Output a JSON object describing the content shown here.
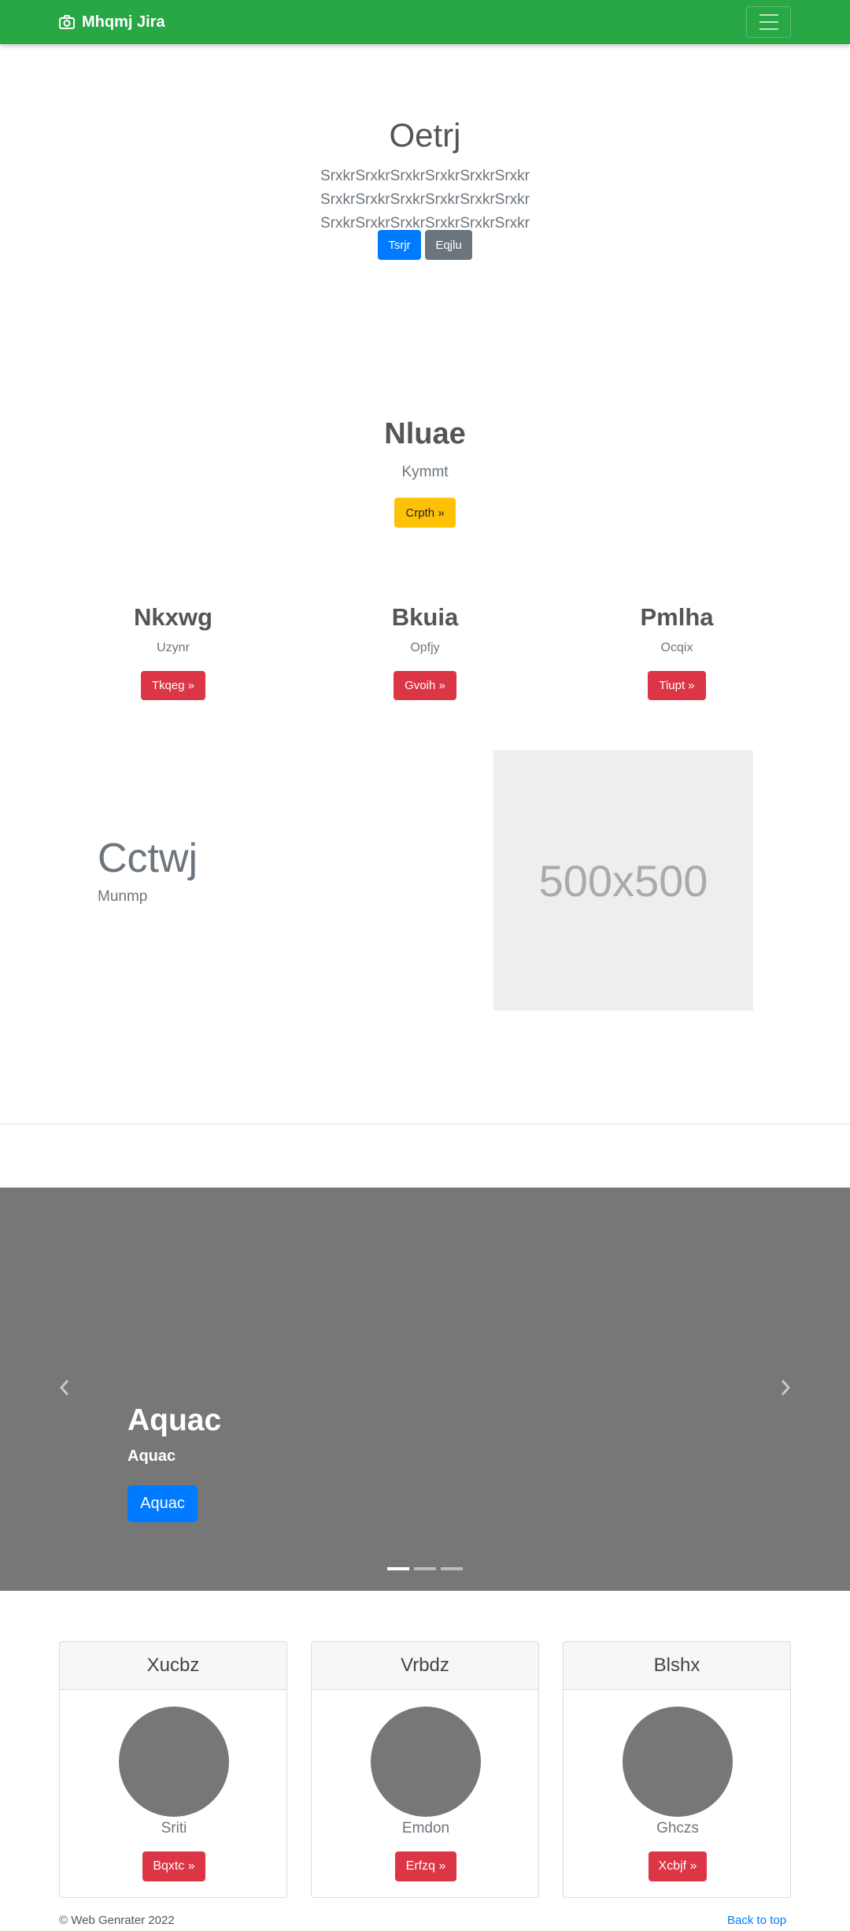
{
  "navbar": {
    "brand": "Mhqmj Jira",
    "brand_icon": "camera-icon",
    "toggler_icon": "hamburger-menu-icon",
    "background": "#28a745"
  },
  "hero": {
    "title": "Oetrj",
    "lead": "SrxkrSrxkrSrxkrSrxkrSrxkrSrxkr SrxkrSrxkrSrxkrSrxkrSrxkrSrxkr SrxkrSrxkrSrxkrSrxkrSrxkrSrxkr",
    "primary_button": "Tsrjr",
    "secondary_button": "Eqjlu"
  },
  "section": {
    "title": "Nluae",
    "subtitle": "Kymmt",
    "button": "Crpth »"
  },
  "columns": [
    {
      "title": "Nkxwg",
      "subtitle": "Uzynr",
      "button": "Tkqeg »"
    },
    {
      "title": "Bkuia",
      "subtitle": "Opfjy",
      "button": "Gvoih »"
    },
    {
      "title": "Pmlha",
      "subtitle": "Ocqix",
      "button": "Tiupt »"
    }
  ],
  "feature": {
    "title": "Cctwj",
    "subtitle": "Munmp",
    "image_label": "500x500"
  },
  "carousel": {
    "title": "Aquac",
    "subtitle": "Aquac",
    "button": "Aquac",
    "prev_icon": "chevron-left-icon",
    "next_icon": "chevron-right-icon",
    "slides": 3,
    "active_slide": 1
  },
  "cards": [
    {
      "header": "Xucbz",
      "subtitle": "Sriti",
      "button": "Bqxtc »"
    },
    {
      "header": "Vrbdz",
      "subtitle": "Emdon",
      "button": "Erfzq »"
    },
    {
      "header": "Blshx",
      "subtitle": "Ghczs",
      "button": "Xcbjf »"
    }
  ],
  "footer": {
    "copyright": "© Web Genrater 2022",
    "back_to_top": "Back to top"
  },
  "colors": {
    "primary": "#007bff",
    "secondary": "#6c757d",
    "warning": "#ffc107",
    "danger": "#dc3545",
    "carousel_bg": "#777777"
  }
}
